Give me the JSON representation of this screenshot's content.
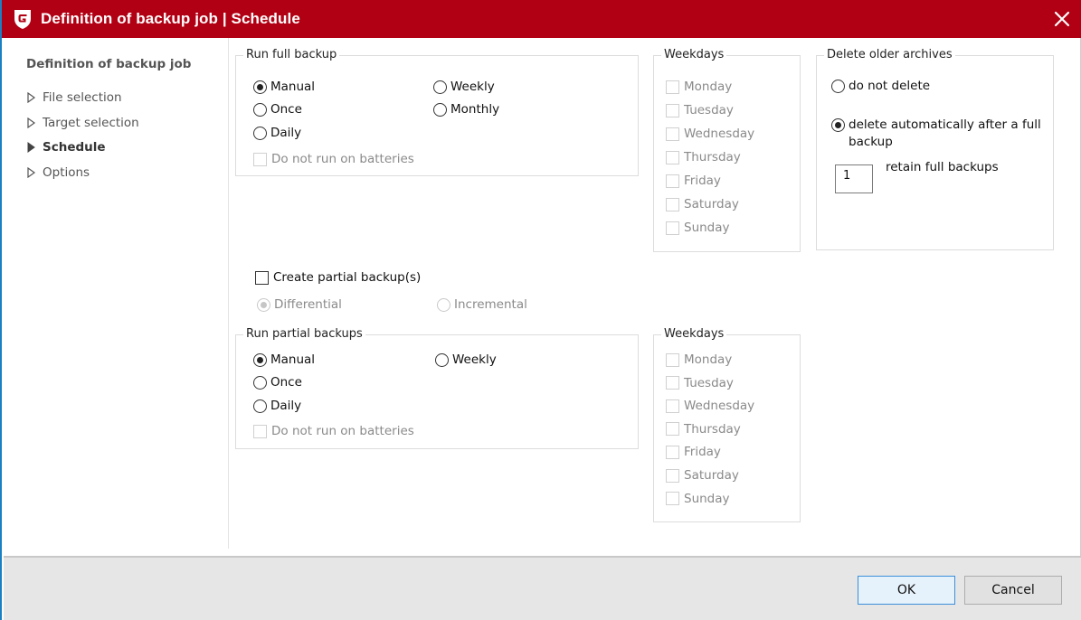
{
  "window": {
    "title": "Definition of backup job | Schedule",
    "accent_color": "#b10013",
    "icons": {
      "logo": "gdata-shield-logo-icon",
      "close": "close-x-icon"
    }
  },
  "sidebar": {
    "heading": "Definition of backup job",
    "items": [
      {
        "label": "File selection",
        "active": false,
        "icon": "triangle-right-outline-icon"
      },
      {
        "label": "Target selection",
        "active": false,
        "icon": "triangle-right-outline-icon"
      },
      {
        "label": "Schedule",
        "active": true,
        "icon": "triangle-right-filled-icon"
      },
      {
        "label": "Options",
        "active": false,
        "icon": "triangle-right-outline-icon"
      }
    ]
  },
  "full_backup": {
    "legend": "Run full backup",
    "options": [
      {
        "label": "Manual",
        "checked": true
      },
      {
        "label": "Once",
        "checked": false
      },
      {
        "label": "Daily",
        "checked": false
      },
      {
        "label": "Weekly",
        "checked": false
      },
      {
        "label": "Monthly",
        "checked": false
      }
    ],
    "batteries": {
      "label": "Do not run on batteries",
      "checked": false,
      "enabled": false
    }
  },
  "full_weekdays": {
    "legend": "Weekdays",
    "days": [
      {
        "label": "Monday",
        "checked": false
      },
      {
        "label": "Tuesday",
        "checked": false
      },
      {
        "label": "Wednesday",
        "checked": false
      },
      {
        "label": "Thursday",
        "checked": false
      },
      {
        "label": "Friday",
        "checked": false
      },
      {
        "label": "Saturday",
        "checked": false
      },
      {
        "label": "Sunday",
        "checked": false
      }
    ],
    "enabled": false
  },
  "delete_archives": {
    "legend": "Delete older archives",
    "options": [
      {
        "label": "do not delete",
        "checked": false
      },
      {
        "label_line1": "delete automatically after a full",
        "label_line2": "backup",
        "checked": true
      }
    ],
    "retain_value": "1",
    "retain_label": "retain full backups"
  },
  "partial": {
    "create_label": "Create partial backup(s)",
    "create_checked": false,
    "types": [
      {
        "label": "Differential",
        "checked": true,
        "enabled": false
      },
      {
        "label": "Incremental",
        "checked": false,
        "enabled": false
      }
    ]
  },
  "partial_backup": {
    "legend": "Run partial backups",
    "options": [
      {
        "label": "Manual",
        "checked": true
      },
      {
        "label": "Once",
        "checked": false
      },
      {
        "label": "Daily",
        "checked": false
      },
      {
        "label": "Weekly",
        "checked": false
      }
    ],
    "batteries": {
      "label": "Do not run on batteries",
      "checked": false,
      "enabled": false
    }
  },
  "partial_weekdays": {
    "legend": "Weekdays",
    "days": [
      {
        "label": "Monday",
        "checked": false
      },
      {
        "label": "Tuesday",
        "checked": false
      },
      {
        "label": "Wednesday",
        "checked": false
      },
      {
        "label": "Thursday",
        "checked": false
      },
      {
        "label": "Friday",
        "checked": false
      },
      {
        "label": "Saturday",
        "checked": false
      },
      {
        "label": "Sunday",
        "checked": false
      }
    ],
    "enabled": false
  },
  "footer": {
    "ok_label": "OK",
    "cancel_label": "Cancel"
  }
}
